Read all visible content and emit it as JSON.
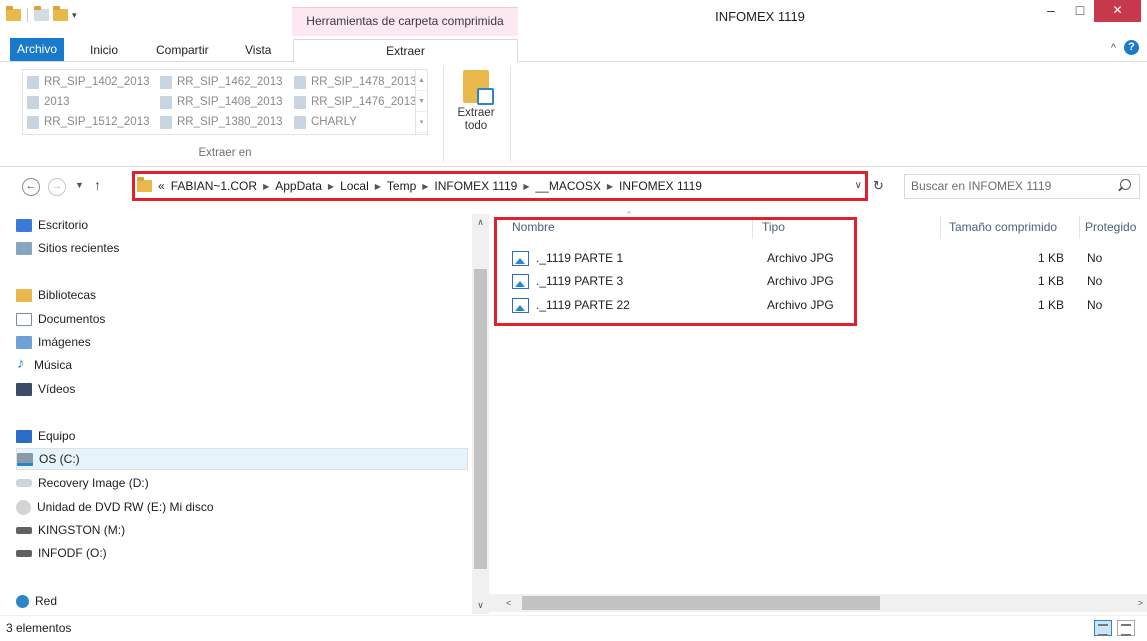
{
  "window": {
    "title": "INFOMEX 1119",
    "contextual_tab_title": "Herramientas de carpeta comprimida",
    "minimize": "–",
    "maximize": "□",
    "close": "✕"
  },
  "ribbon": {
    "tabs": [
      {
        "label": "Archivo"
      },
      {
        "label": "Inicio"
      },
      {
        "label": "Compartir"
      },
      {
        "label": "Vista"
      },
      {
        "label": "Extraer"
      }
    ],
    "collapse": "^",
    "help": "?",
    "extract_to_items": [
      "RR_SIP_1402_2013",
      "RR_SIP_1462_2013",
      "RR_SIP_1478_2013",
      "2013",
      "RR_SIP_1408_2013",
      "RR_SIP_1476_2013",
      "RR_SIP_1512_2013",
      "RR_SIP_1380_2013",
      "CHARLY"
    ],
    "extract_to_label": "Extraer en",
    "extract_all_label_1": "Extraer",
    "extract_all_label_2": "todo"
  },
  "navigation": {
    "breadcrumb_overflow": "«",
    "breadcrumb": [
      "FABIAN~1.COR",
      "AppData",
      "Local",
      "Temp",
      "INFOMEX 1119",
      "__MACOSX",
      "INFOMEX 1119"
    ],
    "search_placeholder": "Buscar en INFOMEX 1119"
  },
  "nav_pane": {
    "items": [
      {
        "label": "Escritorio",
        "icon": "desktop-icon"
      },
      {
        "label": "Sitios recientes",
        "icon": "recent-places-icon"
      },
      {
        "label": "Bibliotecas",
        "icon": "libraries-icon"
      },
      {
        "label": "Documentos",
        "icon": "documents-icon"
      },
      {
        "label": "Imágenes",
        "icon": "pictures-icon"
      },
      {
        "label": "Música",
        "icon": "music-icon"
      },
      {
        "label": "Vídeos",
        "icon": "videos-icon"
      },
      {
        "label": "Equipo",
        "icon": "computer-icon"
      },
      {
        "label": "OS (C:)",
        "icon": "drive-c-icon",
        "selected": true
      },
      {
        "label": "Recovery Image (D:)",
        "icon": "drive-icon"
      },
      {
        "label": "Unidad de DVD RW (E:) Mi disco",
        "icon": "dvd-icon"
      },
      {
        "label": "KINGSTON (M:)",
        "icon": "usb-drive-icon"
      },
      {
        "label": "INFODF (O:)",
        "icon": "usb-drive-icon"
      },
      {
        "label": "Red",
        "icon": "network-icon"
      }
    ]
  },
  "file_list": {
    "columns": [
      "Nombre",
      "Tipo",
      "Tamaño comprimido",
      "Protegido"
    ],
    "rows": [
      {
        "name": "._1119 PARTE 1",
        "type": "Archivo JPG",
        "size": "1 KB",
        "protected": "No"
      },
      {
        "name": "._1119 PARTE 3",
        "type": "Archivo JPG",
        "size": "1 KB",
        "protected": "No"
      },
      {
        "name": "._1119 PARTE 22",
        "type": "Archivo JPG",
        "size": "1 KB",
        "protected": "No"
      }
    ]
  },
  "status": {
    "item_count": "3 elementos"
  },
  "colors": {
    "accent": "#1979ca",
    "highlight_annotation": "#e0202a",
    "contextual_tab": "#fbe8f0"
  }
}
